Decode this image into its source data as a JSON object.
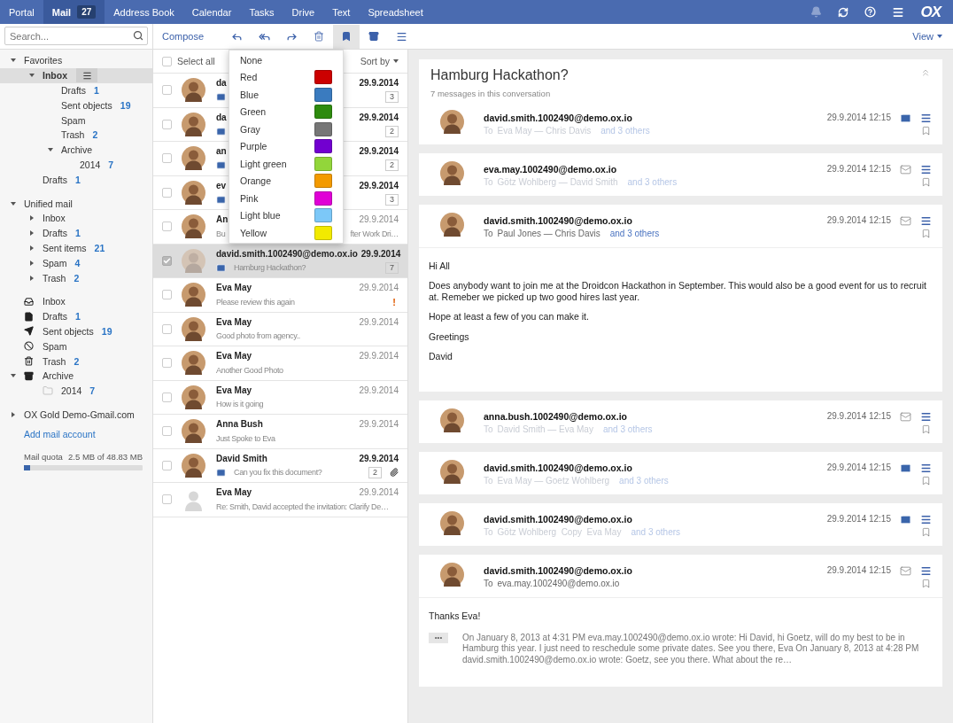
{
  "top_nav": {
    "tabs": [
      {
        "label": "Portal",
        "selected": false
      },
      {
        "label": "Mail",
        "selected": true,
        "badge": "27"
      },
      {
        "label": "Address Book",
        "selected": false
      },
      {
        "label": "Calendar",
        "selected": false
      },
      {
        "label": "Tasks",
        "selected": false
      },
      {
        "label": "Drive",
        "selected": false
      },
      {
        "label": "Text",
        "selected": false
      },
      {
        "label": "Spreadsheet",
        "selected": false
      }
    ],
    "logo": "OX"
  },
  "search": {
    "placeholder": "Search..."
  },
  "toolbar": {
    "compose": "Compose",
    "flag_menu_open": true,
    "view": "View"
  },
  "folders": {
    "groups": [
      [
        {
          "label": "Favorites",
          "expanded": true,
          "selected": false,
          "children": [
            {
              "label": "Inbox",
              "expanded": true,
              "selected": true,
              "children": [
                {
                  "label": "Drafts",
                  "count": "1",
                  "selected": false
                },
                {
                  "label": "Sent objects",
                  "count": "19",
                  "selected": false
                },
                {
                  "label": "Spam",
                  "selected": false
                },
                {
                  "label": "Trash",
                  "count": "2",
                  "selected": false
                },
                {
                  "label": "Archive",
                  "expanded": true,
                  "selected": false,
                  "children": [
                    {
                      "label": "2014",
                      "count": "7",
                      "selected": false
                    }
                  ]
                }
              ]
            },
            {
              "label": "Drafts",
              "count": "1",
              "selected": false
            }
          ]
        }
      ],
      [
        {
          "label": "Unified mail",
          "expanded": true,
          "selected": false,
          "children": [
            {
              "label": "Inbox",
              "expanded": false,
              "selected": false
            },
            {
              "label": "Drafts",
              "count": "1",
              "expanded": false,
              "selected": false
            },
            {
              "label": "Sent items",
              "count": "21",
              "expanded": false,
              "selected": false
            },
            {
              "label": "Spam",
              "count": "4",
              "expanded": false,
              "selected": false
            },
            {
              "label": "Trash",
              "count": "2",
              "expanded": false,
              "selected": false
            }
          ]
        }
      ],
      [
        {
          "label": "Inbox",
          "kind": "inbox",
          "selected": false
        },
        {
          "label": "Drafts",
          "count": "1",
          "kind": "drafts",
          "selected": false
        },
        {
          "label": "Sent objects",
          "count": "19",
          "kind": "sent",
          "selected": false
        },
        {
          "label": "Spam",
          "kind": "spam",
          "selected": false
        },
        {
          "label": "Trash",
          "count": "2",
          "kind": "trash",
          "selected": false
        },
        {
          "label": "Archive",
          "kind": "archive",
          "expanded": true,
          "selected": false,
          "children": [
            {
              "label": "2014",
              "count": "7",
              "kind": "folder",
              "selected": false
            }
          ]
        }
      ],
      [
        {
          "label": "OX Gold Demo-Gmail.com",
          "expanded": false,
          "selected": false
        }
      ]
    ],
    "add_account": "Add mail account",
    "quota": {
      "label": "Mail quota",
      "reading": "2.5 MB of 48.83 MB",
      "level": 0.05
    }
  },
  "list_header": {
    "select_all": "Select all",
    "checked": false,
    "sort": "Sort by"
  },
  "flag_menu": [
    {
      "label": "None"
    },
    {
      "label": "Red",
      "color": "#cc0000"
    },
    {
      "label": "Blue",
      "color": "#3a7bbf"
    },
    {
      "label": "Green",
      "color": "#2e8b0e"
    },
    {
      "label": "Gray",
      "color": "#767676"
    },
    {
      "label": "Purple",
      "color": "#7200d0"
    },
    {
      "label": "Light green",
      "color": "#92d63a"
    },
    {
      "label": "Orange",
      "color": "#f39a00"
    },
    {
      "label": "Pink",
      "color": "#e000d6"
    },
    {
      "label": "Light blue",
      "color": "#7cc8f8"
    },
    {
      "label": "Yellow",
      "color": "#f2ea00"
    }
  ],
  "mails": [
    {
      "sender": "da",
      "date": "29.9.2014",
      "count": "3",
      "unread": true,
      "checked": false,
      "selected": false,
      "has_photo": true
    },
    {
      "sender": "da",
      "date": "29.9.2014",
      "count": "2",
      "unread": true,
      "checked": false,
      "selected": false,
      "has_photo": true
    },
    {
      "sender": "an",
      "date": "29.9.2014",
      "count": "2",
      "unread": true,
      "checked": false,
      "selected": false,
      "has_photo": true
    },
    {
      "sender": "ev",
      "date": "29.9.2014",
      "count": "3",
      "unread": true,
      "checked": false,
      "selected": false,
      "has_photo": true
    },
    {
      "sender": "An",
      "subject": "Bu",
      "subject_end": "fter Work Dri…",
      "date": "29.9.2014",
      "unread": false,
      "checked": false,
      "selected": false,
      "has_photo": true
    },
    {
      "sender": "david.smith.1002490@demo.ox.io",
      "subject": "Hamburg Hackathon?",
      "date": "29.9.2014",
      "count": "7",
      "unread": true,
      "checked": true,
      "selected": true,
      "has_photo": true
    },
    {
      "sender": "Eva May",
      "subject": "Please review this again",
      "date": "29.9.2014",
      "priority": "!",
      "unread": false,
      "checked": false,
      "selected": false,
      "has_photo": true
    },
    {
      "sender": "Eva May",
      "subject": "Good photo from agency..",
      "date": "29.9.2014",
      "unread": false,
      "checked": false,
      "selected": false,
      "has_photo": true
    },
    {
      "sender": "Eva May",
      "subject": "Another Good Photo",
      "date": "29.9.2014",
      "unread": false,
      "checked": false,
      "selected": false,
      "has_photo": true
    },
    {
      "sender": "Eva May",
      "subject": "How is it going",
      "date": "29.9.2014",
      "unread": false,
      "checked": false,
      "selected": false,
      "has_photo": true
    },
    {
      "sender": "Anna Bush",
      "subject": "Just Spoke to Eva",
      "date": "29.9.2014",
      "unread": false,
      "checked": false,
      "selected": false,
      "has_photo": true
    },
    {
      "sender": "David Smith",
      "subject": "Can you fix this document?",
      "date": "29.9.2014",
      "count": "2",
      "attachment": true,
      "unread": true,
      "checked": false,
      "selected": false,
      "has_photo": true
    },
    {
      "sender": "Eva May",
      "subject": "Re: Smith, David accepted the invitation: Clarify De…",
      "date": "29.9.2014",
      "unread": false,
      "checked": false,
      "selected": false,
      "has_photo": false
    }
  ],
  "conversation": {
    "title": "Hamburg Hackathon?",
    "subtitle": "7 messages in this conversation",
    "messages": [
      {
        "from": "david.smith.1002490@demo.ox.io",
        "to_label": "To",
        "recipients": "Eva May — Chris Davis",
        "others": "and 3 others",
        "date": "29.9.2014 12:15",
        "unread": true,
        "expanded": false
      },
      {
        "from": "eva.may.1002490@demo.ox.io",
        "to_label": "To",
        "recipients": "Götz Wohlberg — David Smith",
        "others": "and 3 others",
        "date": "29.9.2014 12:15",
        "unread": false,
        "expanded": false
      },
      {
        "from": "david.smith.1002490@demo.ox.io",
        "to_label": "To",
        "recipients": "Paul Jones — Chris Davis",
        "others": "and 3 others",
        "date": "29.9.2014 12:15",
        "unread": false,
        "expanded": true,
        "body": [
          "Hi All",
          "Does anybody want to join me at the Droidcon Hackathon in September. This would also be a good event for us to recruit at. Remeber we picked up two good hires last year.",
          "Hope at least a few of you can make it.",
          "Greetings",
          "David"
        ]
      },
      {
        "from": "anna.bush.1002490@demo.ox.io",
        "to_label": "To",
        "recipients": "David Smith — Eva May",
        "others": "and 3 others",
        "date": "29.9.2014 12:15",
        "unread": false,
        "expanded": false
      },
      {
        "from": "david.smith.1002490@demo.ox.io",
        "to_label": "To",
        "recipients": "Eva May — Goetz Wohlberg",
        "others": "and 3 others",
        "date": "29.9.2014 12:15",
        "unread": true,
        "expanded": false
      },
      {
        "from": "david.smith.1002490@demo.ox.io",
        "to_label": "To",
        "recipients": "Götz Wohlberg  Copy  Eva May",
        "others": "and 3 others",
        "date": "29.9.2014 12:15",
        "unread": true,
        "expanded": false
      },
      {
        "from": "david.smith.1002490@demo.ox.io",
        "to_label": "To",
        "recipients": "eva.may.1002490@demo.ox.io",
        "date": "29.9.2014 12:15",
        "unread": false,
        "expanded": true,
        "body": [
          "Thanks Eva!"
        ],
        "quote_toggle": "•••",
        "quote": "On January 8, 2013 at 4:31 PM eva.may.1002490@demo.ox.io wrote: Hi David, hi Goetz, will do my best to be in Hamburg this year. I just need to reschedule some private dates. See you there, Eva On January 8, 2013 at 4:28 PM david.smith.1002490@demo.ox.io wrote: Goetz, see you there. What about the re…"
      }
    ]
  }
}
